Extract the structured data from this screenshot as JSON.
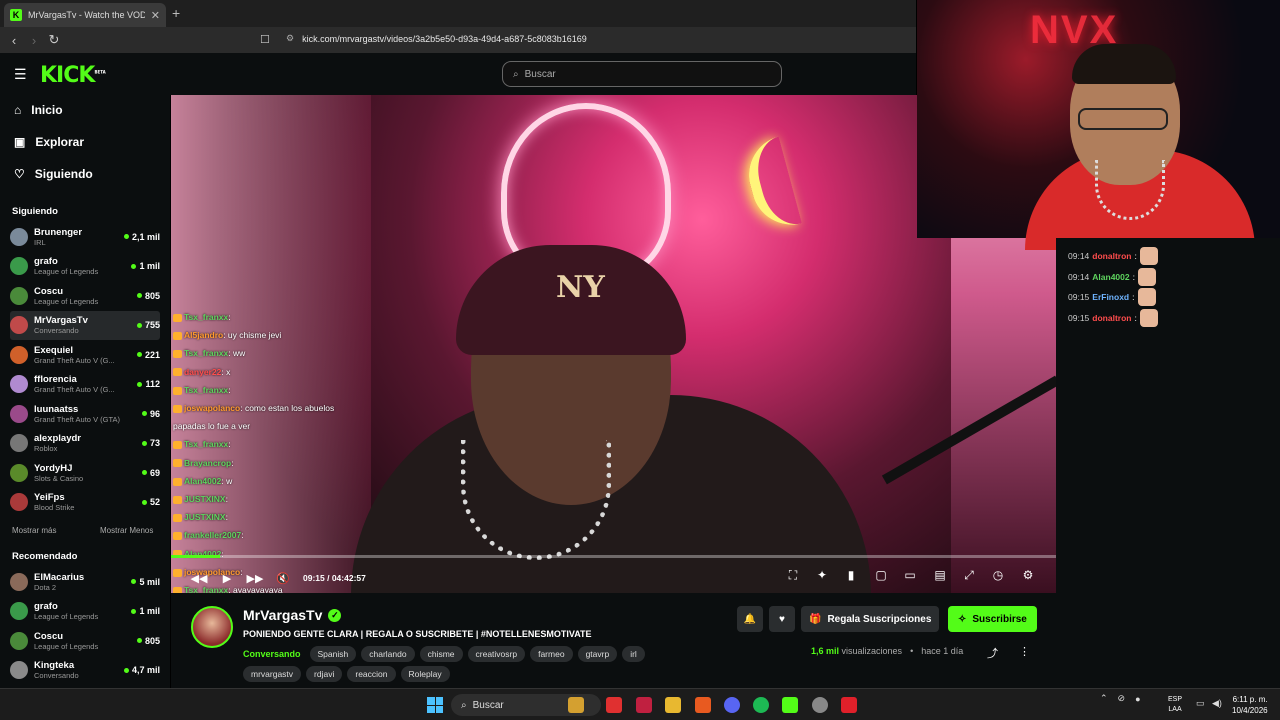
{
  "browser": {
    "tab_title": "MrVargasTv - Watch the VOD on",
    "url": "kick.com/mrvargastv/videos/3a2b5e50-d93a-49d4-a687-5c8083b16169"
  },
  "header": {
    "logo": "KICK",
    "logo_sup": "BETA",
    "search_placeholder": "Buscar"
  },
  "nav": {
    "inicio": "Inicio",
    "explorar": "Explorar",
    "siguiendo": "Siguiendo"
  },
  "sidebar": {
    "following_title": "Siguiendo",
    "following": [
      {
        "name": "Brunenger",
        "category": "IRL",
        "viewers": "2,1 mil",
        "color": "#7a8a9a"
      },
      {
        "name": "grafo",
        "category": "League of Legends",
        "viewers": "1 mil",
        "color": "#3a9a4a"
      },
      {
        "name": "Coscu",
        "category": "League of Legends",
        "viewers": "805",
        "color": "#4a8a3a"
      },
      {
        "name": "MrVargasTv",
        "category": "Conversando",
        "viewers": "755",
        "color": "#c04a4a"
      },
      {
        "name": "Exequiel",
        "category": "Grand Theft Auto V (G...",
        "viewers": "221",
        "color": "#d0602a"
      },
      {
        "name": "fflorencia",
        "category": "Grand Theft Auto V (G...",
        "viewers": "112",
        "color": "#b08ad0"
      },
      {
        "name": "luunaatss",
        "category": "Grand Theft Auto V (GTA)",
        "viewers": "96",
        "color": "#9a4a8a"
      },
      {
        "name": "alexplaydr",
        "category": "Roblox",
        "viewers": "73",
        "color": "#777777"
      },
      {
        "name": "YordyHJ",
        "category": "Slots & Casino",
        "viewers": "69",
        "color": "#5a8a2a"
      },
      {
        "name": "YeiFps",
        "category": "Blood Strike",
        "viewers": "52",
        "color": "#aa3a3a"
      }
    ],
    "show_more": "Mostrar más",
    "show_less": "Mostrar Menos",
    "recommended_title": "Recomendado",
    "recommended": [
      {
        "name": "ElMacarius",
        "category": "Dota 2",
        "viewers": "5 mil",
        "color": "#8a6a5a"
      },
      {
        "name": "grafo",
        "category": "League of Legends",
        "viewers": "1 mil",
        "color": "#3a9a4a"
      },
      {
        "name": "Coscu",
        "category": "League of Legends",
        "viewers": "805",
        "color": "#4a8a3a"
      },
      {
        "name": "Kingteka",
        "category": "Conversando",
        "viewers": "4,7 mil",
        "color": "#8a8a8a"
      }
    ]
  },
  "video_chat": [
    {
      "user": "Tsx_franxx",
      "msg": ":",
      "cls": "u-g"
    },
    {
      "user": "Al5jandro",
      "msg": ": uy chisme jevi",
      "cls": "u-o"
    },
    {
      "user": "Tsx_franxx",
      "msg": ": ww",
      "cls": "u-g"
    },
    {
      "user": "danyer22",
      "msg": ": x",
      "cls": "u-r"
    },
    {
      "user": "Tsx_franxx",
      "msg": ":",
      "cls": "u-g"
    },
    {
      "user": "joswapolanco",
      "msg": ": como estan los abuelos",
      "cls": "u-o"
    },
    {
      "user": "",
      "msg": "papadas lo fue a ver",
      "cls": ""
    },
    {
      "user": "Tsx_franxx",
      "msg": ":",
      "cls": "u-g"
    },
    {
      "user": "Brayancrop",
      "msg": ":",
      "cls": "u-g"
    },
    {
      "user": "Alan4002",
      "msg": ": w",
      "cls": "u-g"
    },
    {
      "user": "JUSTXINX",
      "msg": ":",
      "cls": "u-g"
    },
    {
      "user": "JUSTXINX",
      "msg": ":",
      "cls": "u-g"
    },
    {
      "user": "frankeller2007",
      "msg": ":",
      "cls": "u-g"
    },
    {
      "user": "Alan4002",
      "msg": ":",
      "cls": "u-g"
    },
    {
      "user": "joswapolanco",
      "msg": ":",
      "cls": "u-o"
    },
    {
      "user": "Tsx_franxx",
      "msg": ": ayayayayaya",
      "cls": "u-g"
    }
  ],
  "player": {
    "time": "09:15 / 04:42:57",
    "progress": 0.055
  },
  "stream": {
    "name": "MrVargasTv",
    "title": "PONIENDO GENTE CLARA | REGALA O SUSCRIBETE | #NOTELLENESMOTIVATE",
    "category": "Conversando",
    "tags": [
      "Spanish",
      "charlando",
      "chisme",
      "creativosrp",
      "farmeo",
      "gtavrp",
      "irl"
    ],
    "tags2": [
      "mrvargastv",
      "rdjavi",
      "reaccion",
      "Roleplay"
    ],
    "gift_label": "Regala Suscripciones",
    "subscribe_label": "Suscribirse",
    "views": "1,6 mil",
    "views_label": "visualizaciones",
    "ago": "hace 1 día"
  },
  "webcam_sign": "NVX",
  "right_chat": [
    {
      "time": "09:14",
      "user": "donaltron",
      "cls": "u-r"
    },
    {
      "time": "09:14",
      "user": "Alan4002",
      "cls": "u-g"
    },
    {
      "time": "09:15",
      "user": "ErFinoxd",
      "cls": "u-b"
    },
    {
      "time": "09:15",
      "user": "donaltron",
      "cls": "u-r"
    }
  ],
  "taskbar": {
    "search": "Buscar",
    "lang_top": "ESP",
    "lang_bottom": "LAA",
    "time": "6:11 p. m.",
    "date": "10/4/2026"
  },
  "colors": {
    "accent": "#53fc18",
    "bg": "#0b0e0f"
  }
}
